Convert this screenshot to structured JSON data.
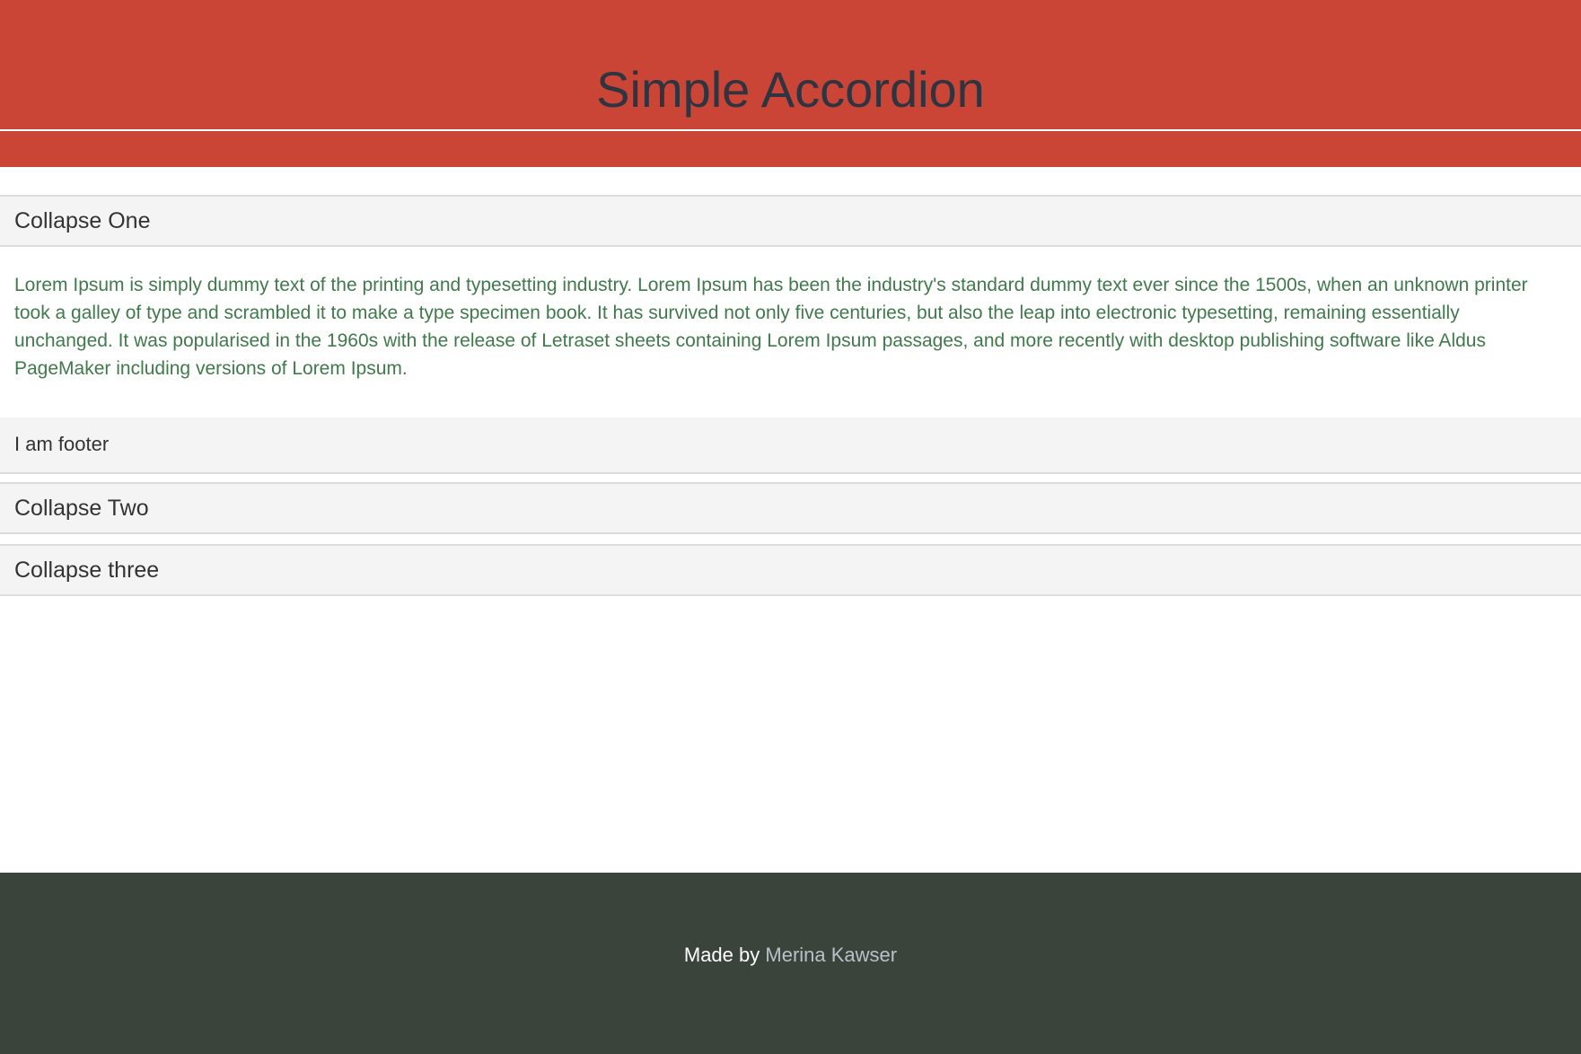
{
  "header": {
    "title": "Simple Accordion",
    "background_color": "#cb4536"
  },
  "accordion": {
    "panels": [
      {
        "title": "Collapse One",
        "expanded": true,
        "body": "Lorem Ipsum is simply dummy text of the printing and typesetting industry. Lorem Ipsum has been the industry's standard dummy text ever since the 1500s, when an unknown printer took a galley of type and scrambled it to make a type specimen book. It has survived not only five centuries, but also the leap into electronic typesetting, remaining essentially unchanged. It was popularised in the 1960s with the release of Letraset sheets containing Lorem Ipsum passages, and more recently with desktop publishing software like Aldus PageMaker including versions of Lorem Ipsum.",
        "footer": "I am footer"
      },
      {
        "title": "Collapse Two",
        "expanded": false
      },
      {
        "title": "Collapse three",
        "expanded": false
      }
    ],
    "body_text_color": "#3f7a4a"
  },
  "site_footer": {
    "prefix": "Made by",
    "author": "Merina Kawser",
    "background_color": "#3a443b"
  }
}
